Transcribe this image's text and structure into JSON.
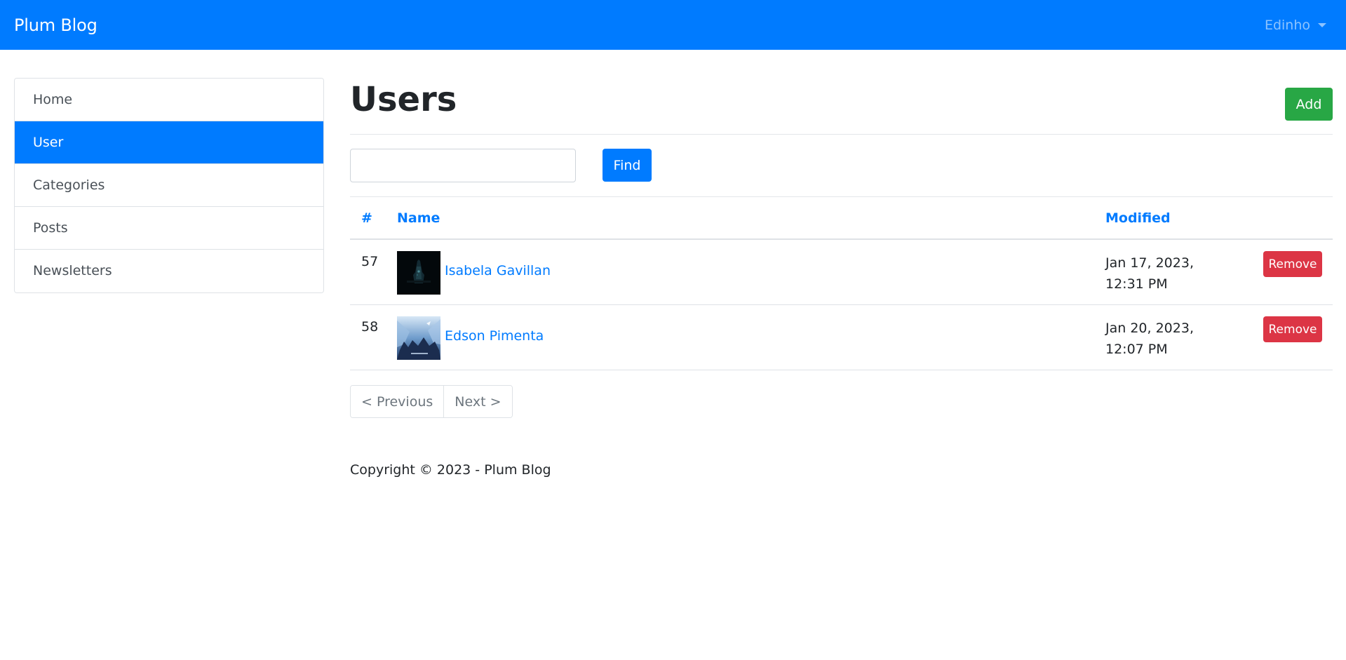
{
  "navbar": {
    "brand": "Plum Blog",
    "user_name": "Edinho"
  },
  "sidebar": {
    "items": [
      {
        "label": "Home"
      },
      {
        "label": "User",
        "active": true
      },
      {
        "label": "Categories"
      },
      {
        "label": "Posts"
      },
      {
        "label": "Newsletters"
      }
    ]
  },
  "main": {
    "title": "Users",
    "add_label": "Add",
    "search": {
      "value": "",
      "placeholder": ""
    },
    "find_label": "Find",
    "table": {
      "headers": {
        "num": "#",
        "name": "Name",
        "modified": "Modified"
      },
      "rows": [
        {
          "id": "57",
          "name": "Isabela Gavillan",
          "modified": "Jan 17, 2023, 12:31 PM",
          "remove_label": "Remove",
          "avatar": "dark-avatar-image"
        },
        {
          "id": "58",
          "name": "Edson Pimenta",
          "modified": "Jan 20, 2023, 12:07 PM",
          "remove_label": "Remove",
          "avatar": "blue-avatar-image"
        }
      ]
    },
    "pagination": {
      "previous": "< Previous",
      "next": "Next >"
    },
    "footer": "Copyright © 2023 - Plum Blog"
  },
  "colors": {
    "primary": "#007bff",
    "success": "#28a745",
    "danger": "#dc3545"
  }
}
